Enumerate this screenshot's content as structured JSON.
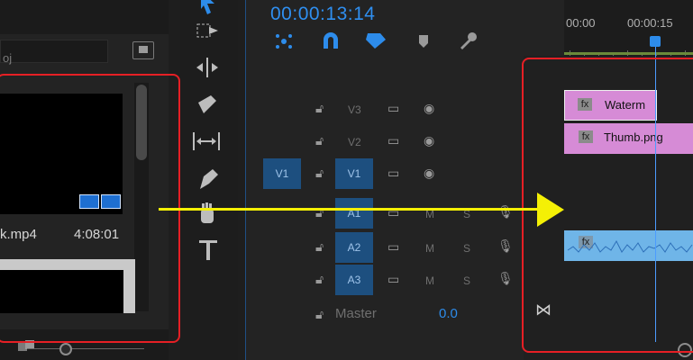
{
  "project": {
    "field_text": "oj",
    "clip_name": "k.mp4",
    "clip_duration": "4:08:01"
  },
  "timeline": {
    "timecode": "00:00:13:14",
    "ruler": [
      "00:00",
      "00:00:15"
    ],
    "tracks": {
      "v3": "V3",
      "v2": "V2",
      "v1": "V1",
      "a1": "A1",
      "a2": "A2",
      "a3": "A3",
      "master": "Master",
      "master_value": "0.0",
      "source_v1": "V1",
      "mute": "M",
      "solo": "S"
    },
    "clips": {
      "watermark": "Waterm",
      "thumb": "Thumb.png",
      "fx": "fx"
    }
  },
  "colors": {
    "highlight": "#e61f25",
    "arrow": "#f4f005",
    "accent": "#2d8ceb",
    "video_clip": "#d68bd6",
    "audio_clip": "#6fb5e8"
  }
}
